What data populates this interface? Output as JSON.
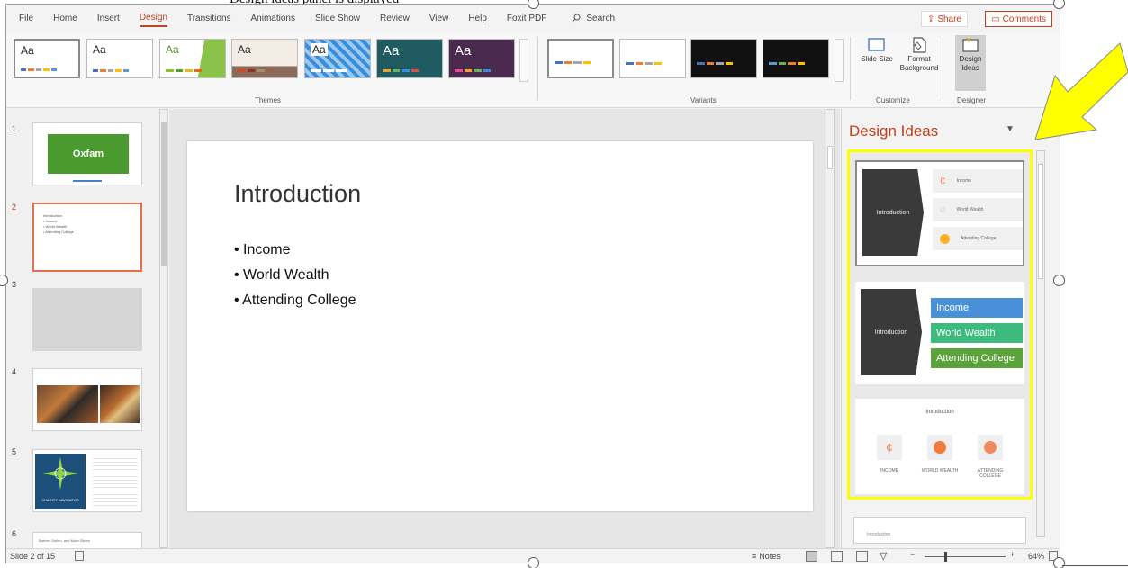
{
  "caption_fragment": "Design ideas panel is displayed",
  "menu": {
    "items": [
      "File",
      "Home",
      "Insert",
      "Design",
      "Transitions",
      "Animations",
      "Slide Show",
      "Review",
      "View",
      "Help",
      "Foxit PDF"
    ],
    "active": "Design",
    "search_label": "Search",
    "share_label": "Share",
    "comments_label": "Comments"
  },
  "ribbon": {
    "themes_label": "Themes",
    "variants_label": "Variants",
    "customize_label": "Customize",
    "designer_label": "Designer",
    "theme_aa": [
      "Aa",
      "Aa",
      "Aa",
      "Aa",
      "Aa",
      "Aa",
      "Aa"
    ],
    "slide_size_label": "Slide Size",
    "format_background_label": "Format Background",
    "design_ideas_label": "Design Ideas"
  },
  "thumbnails": {
    "numbers": [
      "1",
      "2",
      "3",
      "4",
      "5",
      "6"
    ],
    "slide1_logo": "Oxfam",
    "slide2_lines": [
      "Introduction",
      "• Income",
      "• World Wealth",
      "• Attending College"
    ],
    "slide5_text": "CHARITY NAVIGATOR",
    "slide6_text": "Barber, Gellen, and More Slides"
  },
  "slide": {
    "title": "Introduction",
    "bullets": [
      "Income",
      "World Wealth",
      "Attending College"
    ]
  },
  "designer": {
    "title": "Design Ideas",
    "idea1": {
      "title": "Introduction",
      "rows": [
        "Income",
        "World Wealth",
        "Attending College"
      ]
    },
    "idea2": {
      "title": "Introduction",
      "chips": [
        "Income",
        "World Wealth",
        "Attending College"
      ]
    },
    "idea3": {
      "title": "Introduction",
      "labels": [
        "INCOME",
        "WORLD WEALTH",
        "ATTENDING COLLEGE"
      ]
    },
    "idea4_text": "Introduction"
  },
  "status": {
    "slide_counter": "Slide 2 of 15",
    "notes_label": "Notes",
    "zoom": "64%"
  },
  "colors": {
    "accent": "#c43e1c",
    "highlight": "#ffff00",
    "chip_blue": "#4a90d9",
    "chip_green": "#3dba7e",
    "chip_darkgreen": "#5ba33b",
    "oxfam_green": "#4a9a2f"
  }
}
